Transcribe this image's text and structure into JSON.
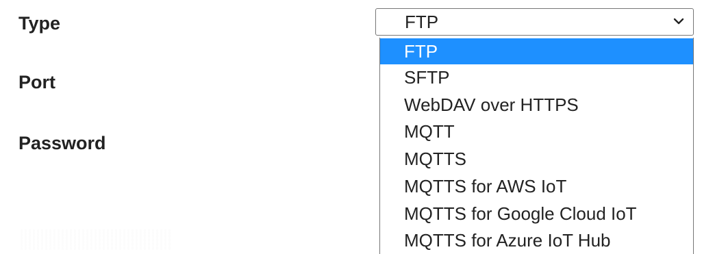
{
  "form": {
    "labels": {
      "type": "Type",
      "port": "Port",
      "password": "Password"
    },
    "type_select": {
      "selected_value": "FTP",
      "icon": "chevron-down-icon",
      "options": [
        "FTP",
        "SFTP",
        "WebDAV over HTTPS",
        "MQTT",
        "MQTTS",
        "MQTTS for AWS IoT",
        "MQTTS for Google Cloud IoT",
        "MQTTS for Azure IoT Hub"
      ],
      "highlighted_option": "FTP"
    }
  },
  "colors": {
    "highlight": "#1e90ff",
    "text": "#222222",
    "border": "#767676"
  }
}
